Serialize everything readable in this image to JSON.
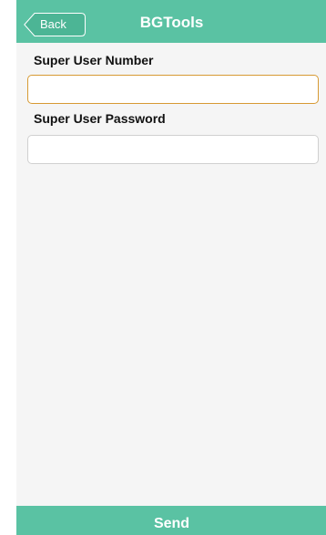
{
  "header": {
    "title": "BGTools",
    "back_label": "Back",
    "color": "#5ac2a3"
  },
  "form": {
    "super_user_number": {
      "label": "Super User Number",
      "value": "",
      "placeholder": "",
      "focused": true,
      "focus_color": "#d79a33"
    },
    "super_user_password": {
      "label": "Super User Password",
      "value": "",
      "placeholder": ""
    }
  },
  "footer": {
    "send_label": "Send"
  },
  "icons": {
    "back": "back-arrow-icon"
  }
}
